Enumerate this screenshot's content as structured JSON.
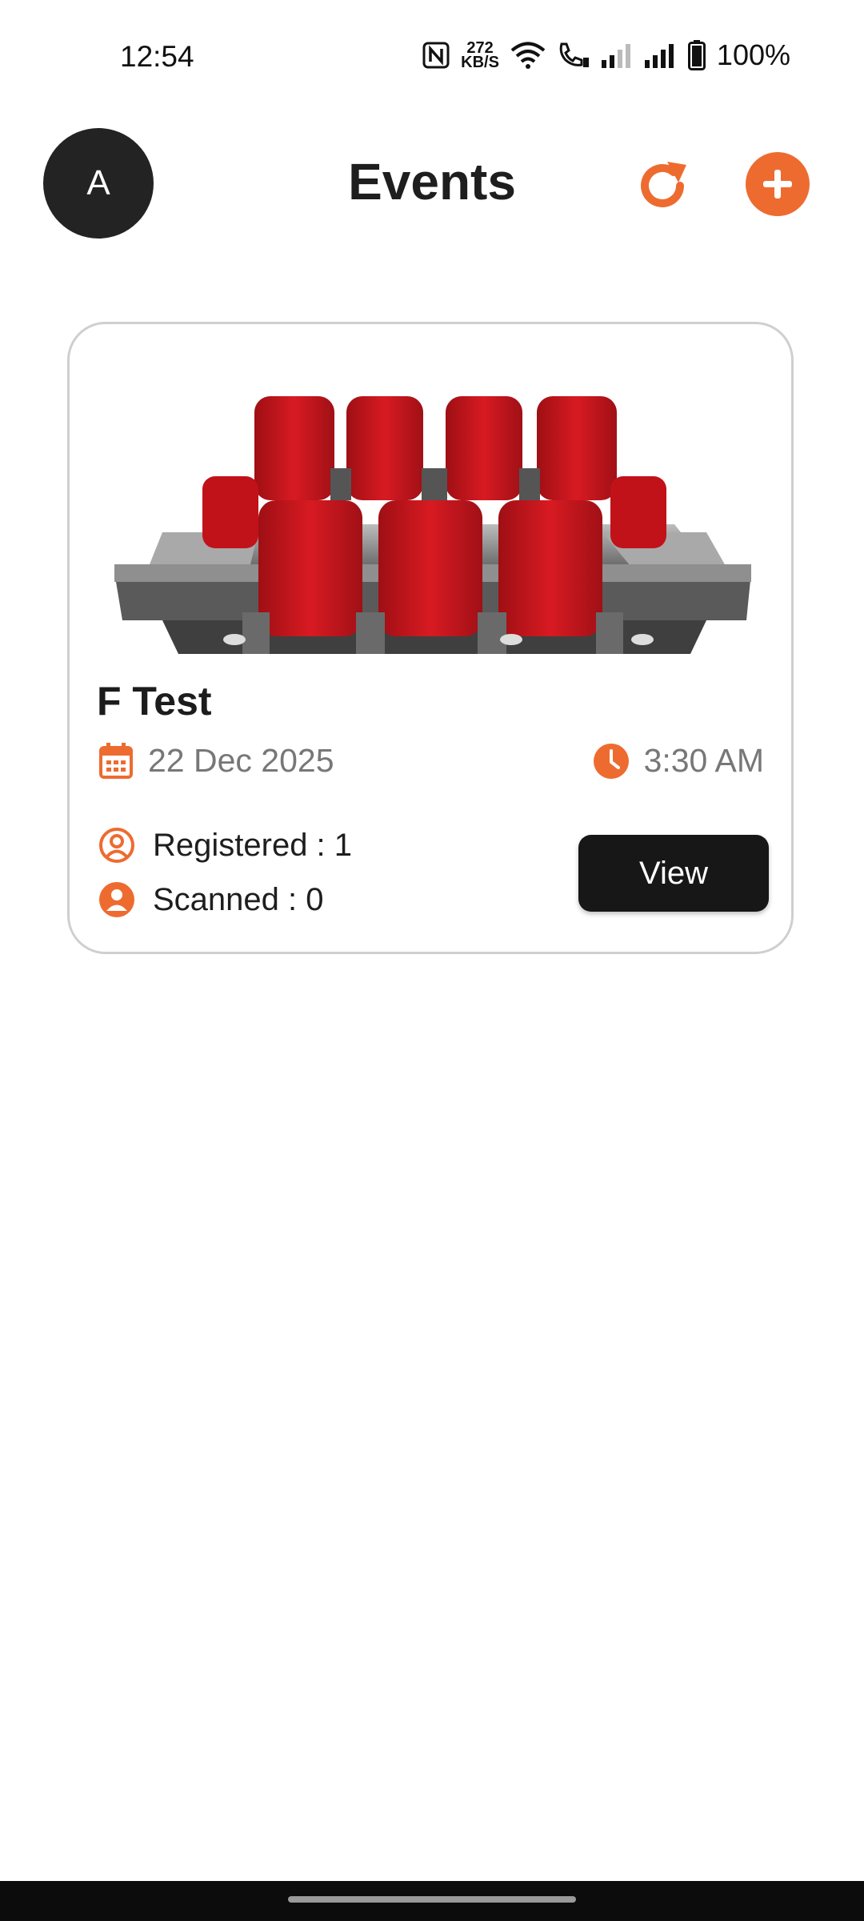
{
  "status_bar": {
    "time": "12:54",
    "net_speed_value": "272",
    "net_speed_unit": "KB/S",
    "battery": "100%",
    "icons": [
      "nfc-icon",
      "wifi-icon",
      "call-icon",
      "signal-icon",
      "signal-icon",
      "battery-icon"
    ]
  },
  "header": {
    "avatar_letter": "A",
    "title": "Events",
    "refresh_icon": "refresh-icon",
    "add_icon": "plus-icon"
  },
  "events": [
    {
      "name": "F Test",
      "date": "22 Dec 2025",
      "time": "3:30 AM",
      "registered_label": "Registered : 1",
      "scanned_label": "Scanned : 0",
      "view_label": "View",
      "image": "cinema-seats-image"
    }
  ],
  "colors": {
    "accent": "#ee6b30",
    "dark": "#171717",
    "muted_text": "#777777",
    "seat_red": "#c8141c"
  }
}
